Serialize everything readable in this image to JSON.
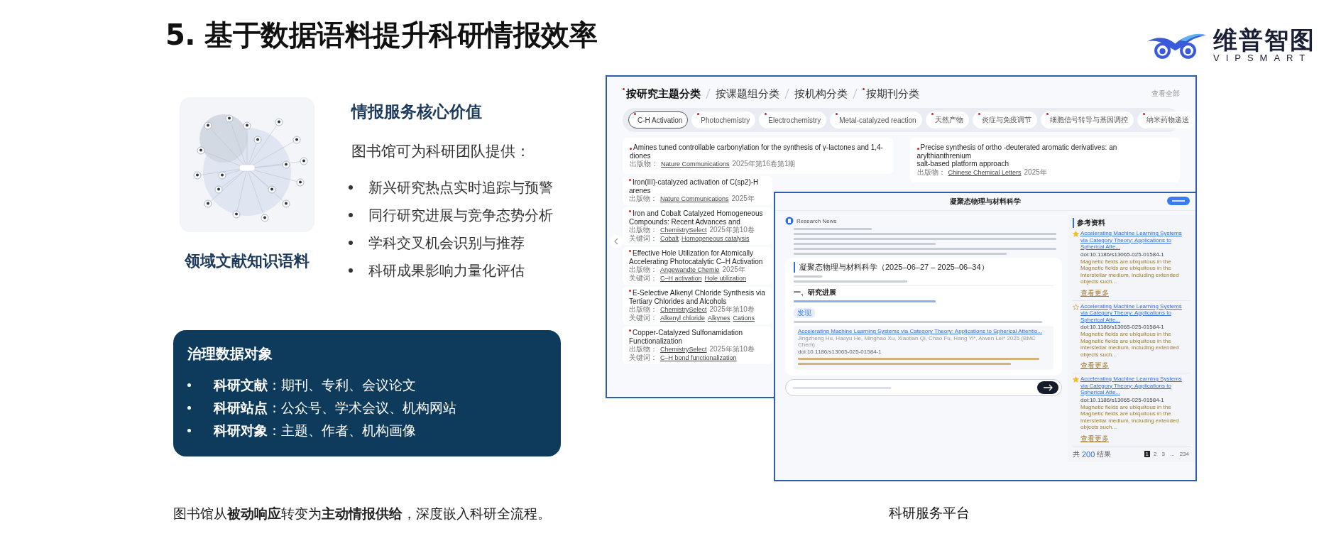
{
  "title": "5. 基于数据语料提升科研情报效率",
  "logo": {
    "name": "维普智图",
    "subtitle": "VIPSMART"
  },
  "corpus": {
    "caption": "领域文献知识语料"
  },
  "value": {
    "heading": "情报服务核心价值",
    "intro": "图书馆可为科研团队提供：",
    "bullets": [
      "新兴研究热点实时追踪与预警",
      "同行研究进展与竞争态势分析",
      "学科交叉机会识别与推荐",
      "科研成果影响力量化评估"
    ]
  },
  "governance": {
    "heading": "治理数据对象",
    "items": [
      "**科研文献**：期刊、专利、会议论文",
      "**科研站点**：公众号、学术会议、机构网站",
      "**科研对象**：主题、作者、机构画像"
    ]
  },
  "conclusion": "图书馆从**被动响应**转变为**主动情报供给**，深度嵌入科研全流程。",
  "platform": {
    "caption": "科研服务平台",
    "tabs": [
      {
        "label": "按研究主题分类",
        "selected": true,
        "marked": true
      },
      {
        "label": "按课题组分类",
        "selected": false,
        "marked": false
      },
      {
        "label": "按机构分类",
        "selected": false,
        "marked": false
      },
      {
        "label": "按期刊分类",
        "selected": false,
        "marked": true
      }
    ],
    "view_all": "查看全部",
    "chips": [
      {
        "label": "C-H Activation",
        "selected": true
      },
      {
        "label": "Photochemistry",
        "selected": false
      },
      {
        "label": "Electrochemistry",
        "selected": false
      },
      {
        "label": "Metal-catalyzed reaction",
        "selected": false
      },
      {
        "label": "天然产物",
        "selected": false
      },
      {
        "label": "炎症与免疫调节",
        "selected": false
      },
      {
        "label": "细胞信号转导与基因调控",
        "selected": false
      },
      {
        "label": "纳米药物递送",
        "selected": false
      }
    ],
    "articles_left": [
      {
        "title": [
          "Amines tuned controllable carbonylation for the synthesis of γ-lactones and 1,4-",
          "diones"
        ],
        "source_label": "出版物：",
        "journal": "Nature Communications",
        "issue": "2025年第16卷第1期"
      },
      {
        "title": [
          "Iron(III)-catalyzed activation of C(sp2)-H",
          "arenes"
        ],
        "source_label": "出版物：",
        "journal": "Nature Communications",
        "issue": "2025年"
      },
      {
        "title": [
          "Iron and Cobalt Catalyzed Homogeneous",
          "Compounds: Recent Advances and"
        ],
        "source_label": "出版物：",
        "journal": "ChemistrySelect",
        "issue": "2025年第10卷",
        "keywords_label": "关键词：",
        "keywords": [
          "Cobalt",
          "Homogeneous catalysis"
        ]
      },
      {
        "title": [
          "Effective Hole Utilization for Atomically",
          "Accelerating Photocatalytic C–H Activation"
        ],
        "source_label": "出版物：",
        "journal": "Angewandte Chemie",
        "issue": "2025年",
        "keywords_label": "关键词：",
        "keywords": [
          "C–H activation",
          "Hole utilization"
        ]
      },
      {
        "title": [
          "E-Selective Alkenyl Chloride Synthesis via",
          "Tertiary Chlorides and Alcohols"
        ],
        "source_label": "出版物：",
        "journal": "ChemistrySelect",
        "issue": "2025年第10卷",
        "keywords_label": "关键词：",
        "keywords": [
          "Alkenyl chloride",
          "Alkynes",
          "Cations"
        ]
      },
      {
        "title": [
          "Copper-Catalyzed Sulfonamidation",
          "Functionalization"
        ],
        "source_label": "出版物：",
        "journal": "ChemistrySelect",
        "issue": "2025年第10卷",
        "keywords_label": "关键词：",
        "keywords": [
          "C–H bond functionalization"
        ]
      }
    ],
    "articles_right": [
      {
        "title": [
          "Precise synthesis of ortho -deuterated aromatic derivatives: an arylthianthrenium",
          "salt-based platform approach"
        ],
        "source_label": "出版物：",
        "journal": "Chinese Chemical Letters",
        "issue": "2025年"
      }
    ],
    "report": {
      "header_title": "凝聚态物理与材料科学",
      "brand": "Research News",
      "section_title": "凝聚态物理与材料科学（2025–06–27 – 2025–06–34）",
      "subheading": "一、研究进展",
      "tag": "发现",
      "citation_title": "Accelerating Machine Learning Systems via Category Theory: Applications to Spherical Attentio...",
      "citation_authors": "Jingzheng Hu, Haoyu He, Minghao Xu, Xiaotian Qi, Chao Fu, Hang Yi*, Alwen Lei* 2025 (BMC Chem)",
      "citation_doi": "doi:10.1186/s13065-025-01584-1",
      "references": {
        "heading": "参考资料",
        "items": [
          {
            "starred": true,
            "title": "Accelerating Machine Learning Systems via Category Theory: Applications to Spherical Atte...",
            "doi": "doi:10.1186/s13065-025-01584-1",
            "summary": "Magnetic fields are ubiquitous in the Magnetic fields are ubiquitous in the interstellar medium, including extended objects such...",
            "more": "查看更多"
          },
          {
            "starred": false,
            "title": "Accelerating Machine Learning Systems via Category Theory: Applications to Spherical Atte...",
            "doi": "doi:10.1186/s13065-025-01584-1",
            "summary": "Magnetic fields are ubiquitous in the Magnetic fields are ubiquitous in the interstellar medium, including extended objects such...",
            "more": "查看更多"
          },
          {
            "starred": true,
            "title": "Accelerating Machine Learning Systems via Category Theory: Applications to Spherical Atte...",
            "doi": "doi:10.1186/s13065-025-01584-1",
            "summary": "Magnetic fields are ubiquitous in the Magnetic fields are ubiquitous in the interstellar medium, including extended objects such...",
            "more": "查看更多"
          }
        ]
      },
      "total_label": "共",
      "total": "200",
      "total_unit": "结果",
      "pages": [
        {
          "label": "1",
          "selected": true
        },
        {
          "label": "2",
          "selected": false
        },
        {
          "label": "3",
          "selected": false
        },
        {
          "label": "...",
          "selected": false
        },
        {
          "label": "234",
          "selected": false
        }
      ]
    }
  }
}
